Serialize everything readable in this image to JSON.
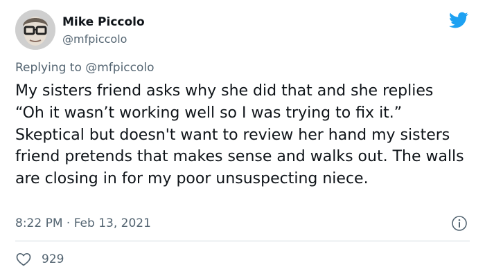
{
  "tweet": {
    "author_name": "Mike Piccolo",
    "author_handle": "@mfpiccolo",
    "replying_prefix": "Replying to",
    "replying_handle": "@mfpiccolo",
    "text": "My sisters friend asks why she did that and she replies “Oh it wasn’t working well so I was trying to fix it.” Skeptical but doesn't want to review her hand my sisters friend pretends that makes sense and walks out. The walls are closing in for my poor unsuspecting niece.",
    "timestamp": "8:22 PM · Feb 13, 2021",
    "like_count": "929"
  },
  "icons": {
    "avatar": "avatar",
    "brand": "twitter-bird-icon",
    "info": "info-icon",
    "like": "heart-icon"
  },
  "colors": {
    "brand": "#1da1f2",
    "text": "#0f1419",
    "muted": "#536471",
    "divider": "#cfd9de"
  }
}
